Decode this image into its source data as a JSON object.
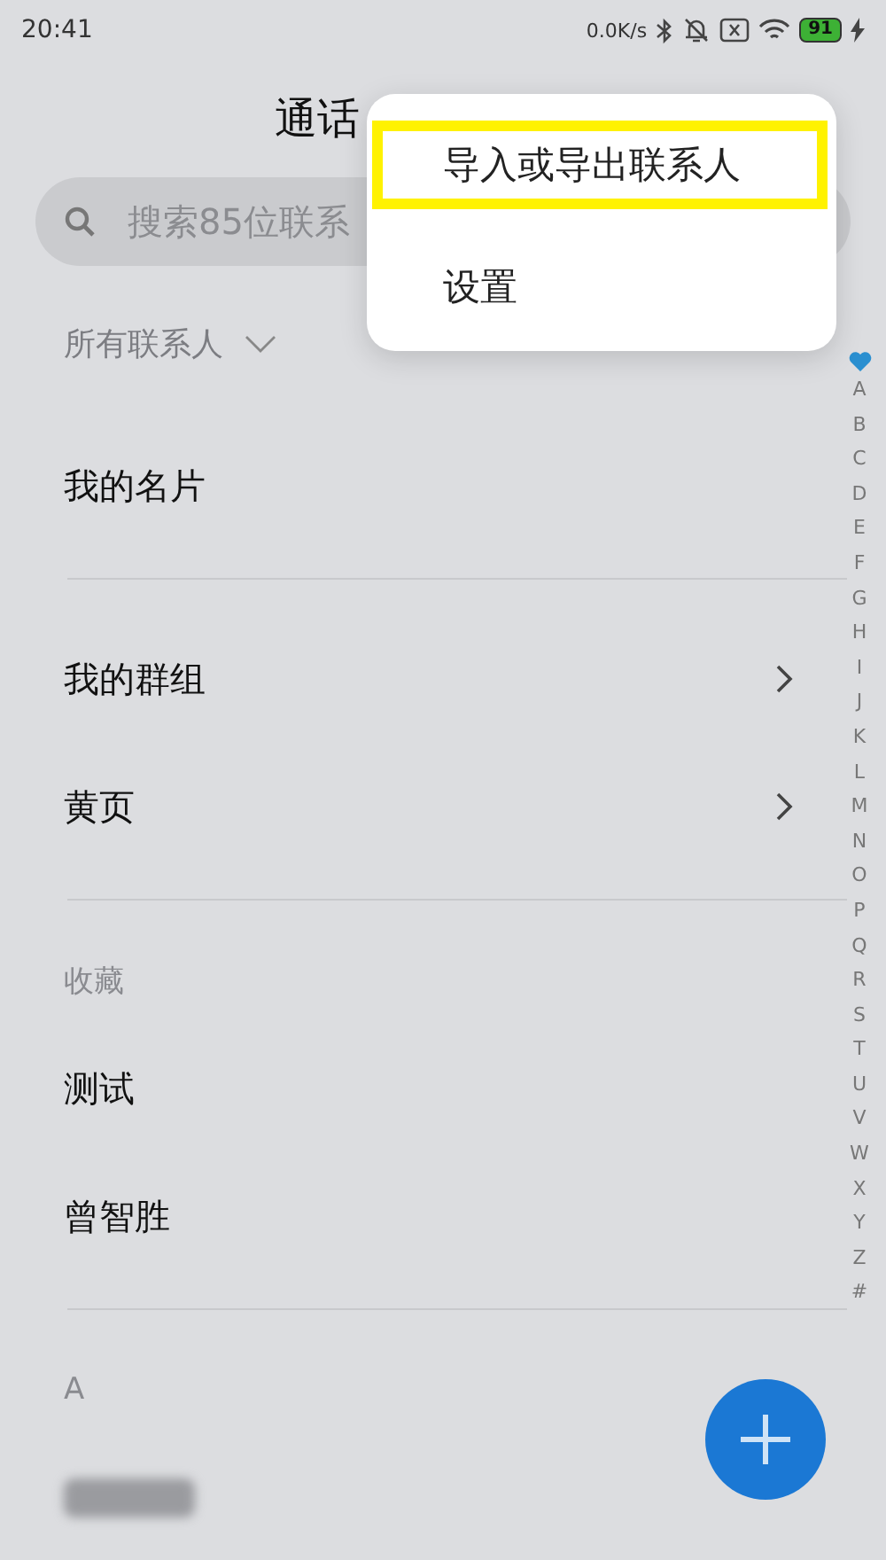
{
  "status_bar": {
    "time": "20:41",
    "net_speed": "0.0K/s",
    "battery": "91"
  },
  "title": "通话",
  "search": {
    "placeholder": "搜索85位联系"
  },
  "filter": {
    "label": "所有联系人"
  },
  "items": [
    {
      "kind": "row",
      "label": "我的名片"
    },
    {
      "kind": "divider"
    },
    {
      "kind": "link",
      "label": "我的群组"
    },
    {
      "kind": "link",
      "label": "黄页"
    },
    {
      "kind": "divider"
    },
    {
      "kind": "header",
      "label": "收藏"
    },
    {
      "kind": "row",
      "label": "测试"
    },
    {
      "kind": "row",
      "label": "曾智胜"
    },
    {
      "kind": "divider"
    },
    {
      "kind": "header",
      "label": "A"
    },
    {
      "kind": "blurred"
    }
  ],
  "index": [
    "A",
    "B",
    "C",
    "D",
    "E",
    "F",
    "G",
    "H",
    "I",
    "J",
    "K",
    "L",
    "M",
    "N",
    "O",
    "P",
    "Q",
    "R",
    "S",
    "T",
    "U",
    "V",
    "W",
    "X",
    "Y",
    "Z",
    "#"
  ],
  "menu": [
    {
      "label": "导入或导出联系人",
      "highlighted": true
    },
    {
      "label": "设置",
      "highlighted": false
    }
  ]
}
